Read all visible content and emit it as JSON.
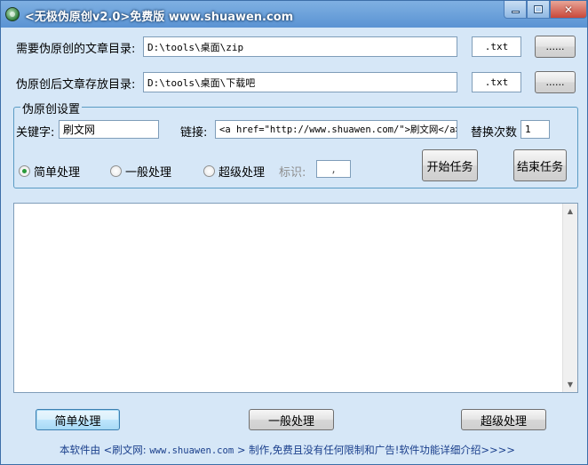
{
  "window": {
    "title": "<无极伪原创v2.0>免费版 www.shuawen.com",
    "controls": {
      "minimize": "minimize",
      "maximize": "maximize",
      "close": "close"
    }
  },
  "source_dir": {
    "label": "需要伪原创的文章目录:",
    "value": "D:\\tools\\桌面\\zip",
    "ext": ".txt",
    "browse": "......"
  },
  "output_dir": {
    "label": "伪原创后文章存放目录:",
    "value": "D:\\tools\\桌面\\下载吧",
    "ext": ".txt",
    "browse": "......"
  },
  "settings": {
    "group_title": "伪原创设置",
    "keyword_label": "关键字:",
    "keyword_value": "刷文网",
    "link_label": "链接:",
    "link_value": "<a href=\"http://www.shuawen.com/\">刷文网</a>",
    "replace_count_label": "替换次数",
    "replace_count_value": "1",
    "modes": [
      {
        "label": "简单处理",
        "selected": true
      },
      {
        "label": "一般处理",
        "selected": false
      },
      {
        "label": "超级处理",
        "selected": false
      }
    ],
    "marker_label": "标识:",
    "marker_value": ",",
    "start_button": "开始任务",
    "stop_button": "结束任务"
  },
  "log": {
    "content": ""
  },
  "bottom_buttons": {
    "simple": "简单处理",
    "normal": "一般处理",
    "super": "超级处理"
  },
  "footer": {
    "prefix": "本软件由 <刷文网:",
    "url": "www.shuawen.com",
    "suffix": "> 制作,免费且没有任何限制和广告!软件功能详细介绍>>>>"
  }
}
